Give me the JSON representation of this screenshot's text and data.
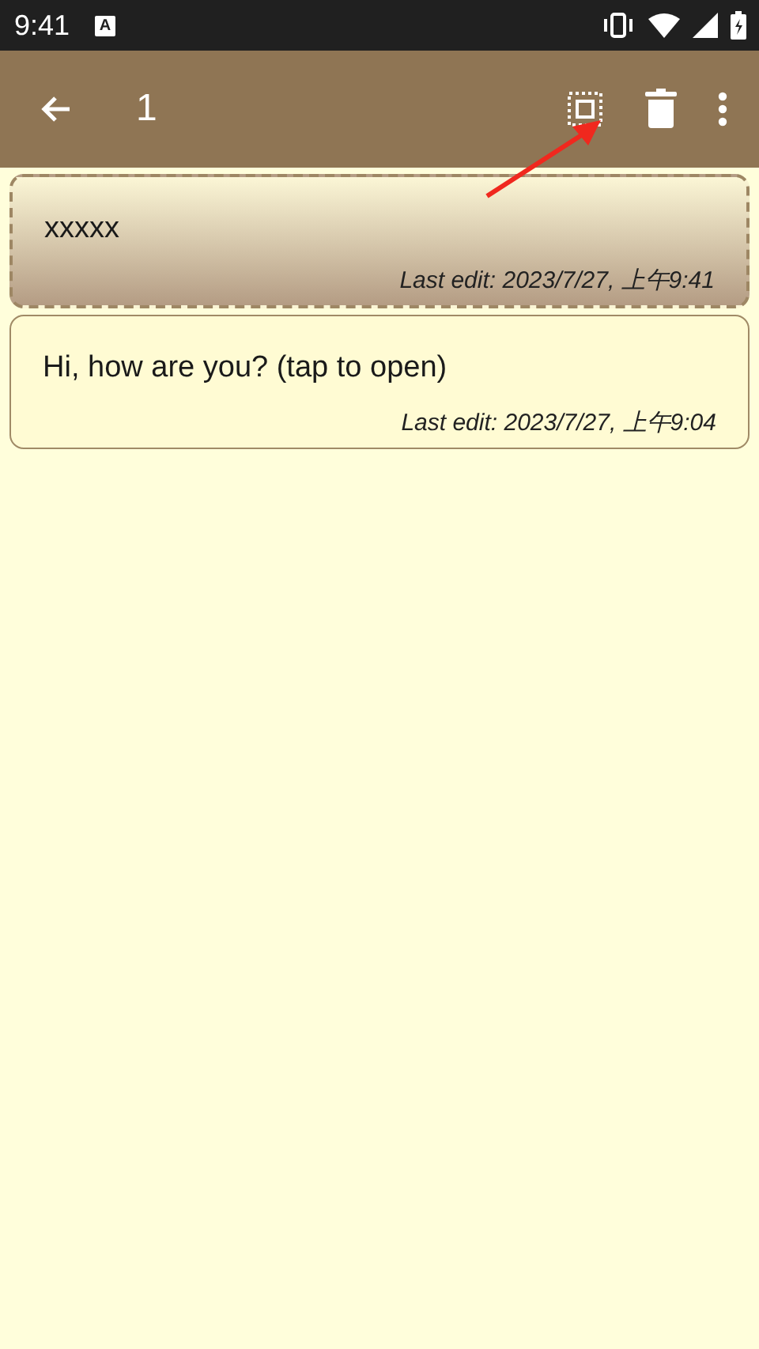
{
  "status_bar": {
    "time": "9:41",
    "notification_letter": "A"
  },
  "toolbar": {
    "title": "1"
  },
  "notes": [
    {
      "text": "xxxxx",
      "last_edit": "Last edit: 2023/7/27, 上午9:41",
      "selected": true
    },
    {
      "text": "Hi, how are you? (tap to open)",
      "last_edit": "Last edit: 2023/7/27, 上午9:04",
      "selected": false
    }
  ]
}
